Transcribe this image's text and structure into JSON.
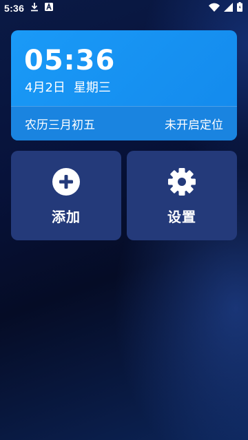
{
  "status_bar": {
    "time": "5:36",
    "icons": [
      "download-icon",
      "a-badge-icon",
      "wifi-icon",
      "signal-icon",
      "battery-icon"
    ]
  },
  "clock_card": {
    "time": "05:36",
    "date": "4月2日",
    "weekday": "星期三",
    "lunar": "农历三月初五",
    "location": "未开启定位"
  },
  "tiles": {
    "add": {
      "label": "添加",
      "icon": "plus-circle-icon"
    },
    "settings": {
      "label": "设置",
      "icon": "gear-icon"
    }
  }
}
